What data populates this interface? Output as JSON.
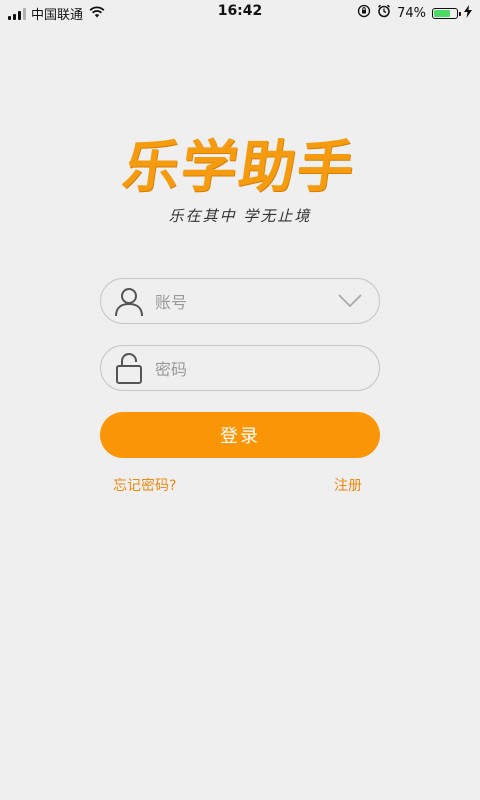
{
  "status_bar": {
    "carrier": "中国联通",
    "time": "16:42",
    "battery_percent": "74%",
    "battery_level": 0.74,
    "icons": [
      "signal-icon",
      "wifi-icon",
      "rotation-lock-icon",
      "alarm-icon",
      "battery-icon",
      "charging-icon"
    ]
  },
  "logo": {
    "title": "乐学助手",
    "slogan": "乐在其中 学无止境"
  },
  "form": {
    "account_placeholder": "账号",
    "password_placeholder": "密码",
    "login_label": "登录",
    "forgot_label": "忘记密码?",
    "register_label": "注册"
  },
  "colors": {
    "accent": "#fb9508",
    "link": "#ee8a10",
    "background": "#efefef",
    "battery": "#4cd964"
  }
}
